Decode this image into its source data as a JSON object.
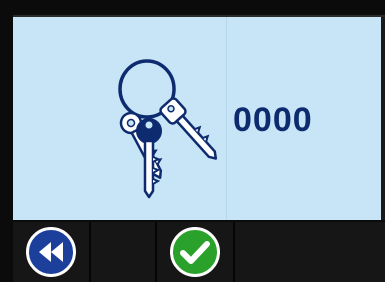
{
  "display": {
    "code": "0000",
    "icon": "keys-icon",
    "background": "#c7e5f6",
    "code_color": "#0d2b6e"
  },
  "toolbar": {
    "buttons": [
      {
        "icon": "rewind-icon",
        "color": "#1d3f9c"
      },
      {
        "icon": "checkmark-icon",
        "color": "#2aa12a"
      }
    ]
  }
}
